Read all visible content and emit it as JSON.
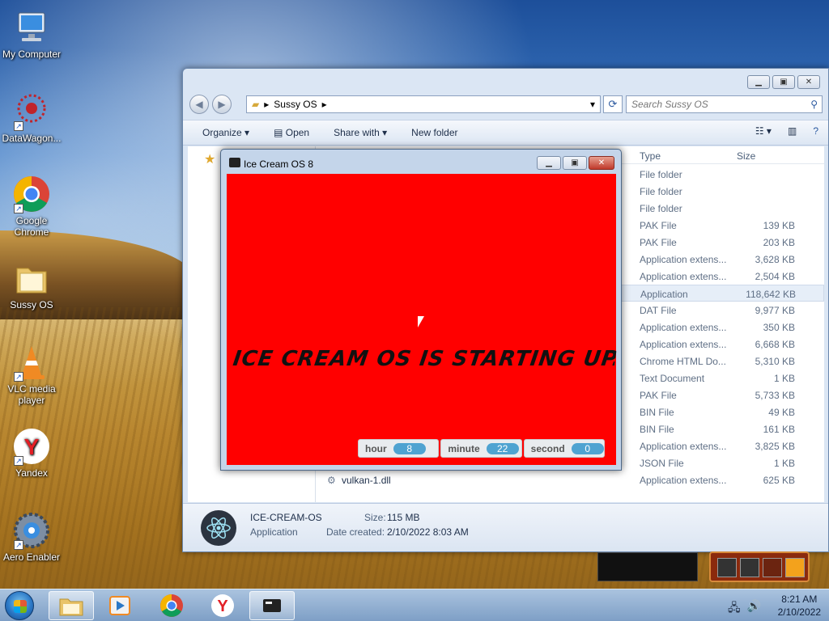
{
  "desktop": {
    "icons": [
      {
        "label": "My Computer"
      },
      {
        "label": "DataWagon..."
      },
      {
        "label": "Google Chrome"
      },
      {
        "label": "Sussy OS"
      },
      {
        "label": "VLC media player"
      },
      {
        "label": "Yandex"
      },
      {
        "label": "Aero Enabler"
      }
    ]
  },
  "explorer": {
    "address": "Sussy OS",
    "search_placeholder": "Search Sussy OS",
    "toolbar": {
      "organize": "Organize",
      "open": "Open",
      "share_with": "Share with",
      "new_folder": "New folder"
    },
    "columns": {
      "type": "Type",
      "size": "Size"
    },
    "files": [
      {
        "name": "",
        "type": "File folder",
        "size": ""
      },
      {
        "name": "",
        "type": "File folder",
        "size": ""
      },
      {
        "name": "",
        "type": "File folder",
        "size": ""
      },
      {
        "name": "",
        "type": "PAK File",
        "size": "139 KB"
      },
      {
        "name": "",
        "type": "PAK File",
        "size": "203 KB"
      },
      {
        "name": "",
        "type": "Application extens...",
        "size": "3,628 KB"
      },
      {
        "name": "",
        "type": "Application extens...",
        "size": "2,504 KB"
      },
      {
        "name": "",
        "type": "Application",
        "size": "118,642 KB"
      },
      {
        "name": "",
        "type": "DAT File",
        "size": "9,977 KB"
      },
      {
        "name": "",
        "type": "Application extens...",
        "size": "350 KB"
      },
      {
        "name": "",
        "type": "Application extens...",
        "size": "6,668 KB"
      },
      {
        "name": "",
        "type": "Chrome HTML Do...",
        "size": "5,310 KB"
      },
      {
        "name": "",
        "type": "Text Document",
        "size": "1 KB"
      },
      {
        "name": "",
        "type": "PAK File",
        "size": "5,733 KB"
      },
      {
        "name": "",
        "type": "BIN File",
        "size": "49 KB"
      },
      {
        "name": "",
        "type": "BIN File",
        "size": "161 KB"
      },
      {
        "name": "",
        "type": "Application extens...",
        "size": "3,825 KB"
      },
      {
        "name": "",
        "type": "JSON File",
        "size": "1 KB"
      },
      {
        "name": "vulkan-1.dll",
        "type": "Application extens...",
        "size": "625 KB"
      }
    ],
    "details": {
      "name": "ICE-CREAM-OS",
      "kind": "Application",
      "size_label": "Size:",
      "size_value": "115 MB",
      "created_label": "Date created:",
      "created_value": "2/10/2022 8:03 AM"
    }
  },
  "icecream": {
    "title": "Ice Cream OS 8",
    "boot_text": "ICE CREAM OS IS STARTING UP...",
    "clock": [
      {
        "label": "hour",
        "value": "8"
      },
      {
        "label": "minute",
        "value": "22"
      },
      {
        "label": "second",
        "value": "0"
      }
    ]
  },
  "taskbar": {
    "time": "8:21 AM",
    "date": "2/10/2022"
  },
  "colors": {
    "stage_red": "#ff0000",
    "clock_pill": "#4fa3d1",
    "taskbar": "#aac3df"
  }
}
